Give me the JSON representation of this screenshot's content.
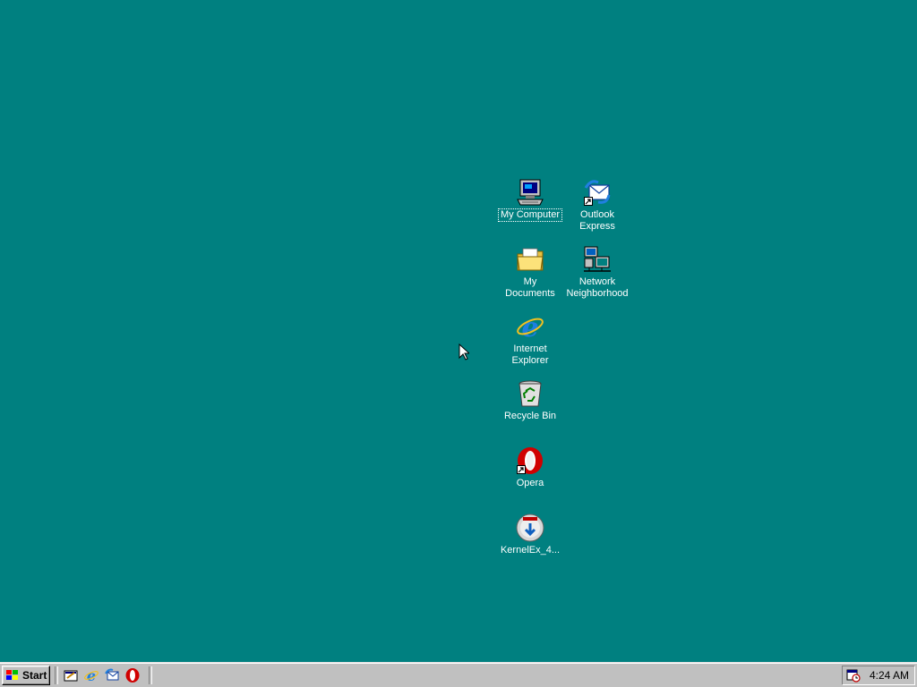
{
  "desktop": {
    "background": "#008080",
    "icons": [
      {
        "id": "my-computer",
        "label": "My Computer",
        "icon": "computer-icon",
        "selected": true
      },
      {
        "id": "outlook-express",
        "label": "Outlook Express",
        "icon": "outlook-express-icon",
        "shortcut": true
      },
      {
        "id": "my-documents",
        "label": "My Documents",
        "icon": "folder-icon"
      },
      {
        "id": "network-neighborhood",
        "label": "Network Neighborhood",
        "icon": "network-icon"
      },
      {
        "id": "internet-explorer",
        "label": "Internet Explorer",
        "icon": "ie-icon"
      },
      {
        "id": "recycle-bin",
        "label": "Recycle Bin",
        "icon": "recycle-bin-icon"
      },
      {
        "id": "opera",
        "label": "Opera",
        "icon": "opera-icon",
        "shortcut": true
      },
      {
        "id": "kernelex",
        "label": "KernelEx_4...",
        "icon": "installer-cd-icon"
      }
    ]
  },
  "taskbar": {
    "start_label": "Start",
    "quick_launch": [
      "show-desktop-icon",
      "ie-icon",
      "outlook-express-icon",
      "opera-icon"
    ],
    "tray": {
      "clock": "4:24 AM",
      "icons": [
        "scheduler-icon"
      ]
    }
  }
}
